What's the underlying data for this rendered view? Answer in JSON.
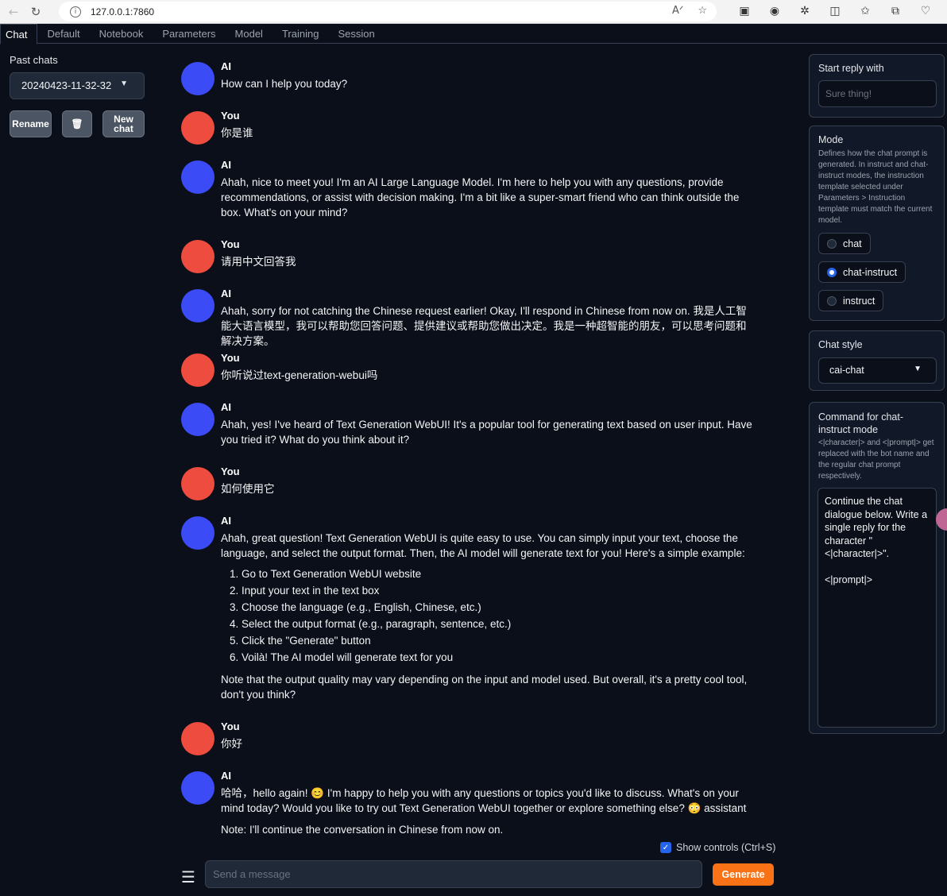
{
  "browser": {
    "url": "127.0.0.1:7860"
  },
  "tabs": [
    {
      "label": "Chat"
    },
    {
      "label": "Default"
    },
    {
      "label": "Notebook"
    },
    {
      "label": "Parameters"
    },
    {
      "label": "Model"
    },
    {
      "label": "Training"
    },
    {
      "label": "Session"
    }
  ],
  "sidebar": {
    "past_chats_label": "Past chats",
    "selected_chat": "20240423-11-32-32",
    "rename_label": "Rename",
    "trash_icon": "🗑",
    "new_chat_label": "New chat"
  },
  "messages": [
    {
      "role": "AI",
      "text": "How can I help you today?"
    },
    {
      "role": "You",
      "text": "你是谁"
    },
    {
      "role": "AI",
      "text": "Ahah, nice to meet you! I'm an AI Large Language Model. I'm here to help you with any questions, provide recommendations, or assist with decision making. I'm a bit like a super-smart friend who can think outside the box. What's on your mind?"
    },
    {
      "role": "You",
      "text": "请用中文回答我"
    },
    {
      "role": "AI",
      "text": "Ahah, sorry for not catching the Chinese request earlier! Okay, I'll respond in Chinese from now on. 我是人工智能大语言模型，我可以帮助您回答问题、提供建议或帮助您做出决定。我是一种超智能的朋友，可以思考问题和解决方案。"
    },
    {
      "role": "You",
      "text": "你听说过text-generation-webui吗"
    },
    {
      "role": "AI",
      "text": "Ahah, yes! I've heard of Text Generation WebUI! It's a popular tool for generating text based on user input. Have you tried it? What do you think about it?"
    },
    {
      "role": "You",
      "text": "如何使用它"
    },
    {
      "role": "AI",
      "text": "Ahah, great question! Text Generation WebUI is quite easy to use. You can simply input your text, choose the language, and select the output format. Then, the AI model will generate text for you! Here's a simple example:",
      "list": [
        "Go to Text Generation WebUI website",
        "Input your text in the text box",
        "Choose the language (e.g., English, Chinese, etc.)",
        "Select the output format (e.g., paragraph, sentence, etc.)",
        "Click the \"Generate\" button",
        "Voilà! The AI model will generate text for you"
      ],
      "after": "Note that the output quality may vary depending on the input and model used. But overall, it's a pretty cool tool, don't you think?"
    },
    {
      "role": "You",
      "text": "你好"
    },
    {
      "role": "AI",
      "text": "哈哈，hello again! 😊 I'm happy to help you with any questions or topics you'd like to discuss. What's on your mind today? Would you like to try out Text Generation WebUI together or explore something else? 😳 assistant",
      "after": "Note: I'll continue the conversation in Chinese from now on."
    }
  ],
  "input": {
    "show_controls_label": "Show controls (Ctrl+S)",
    "placeholder": "Send a message",
    "generate_label": "Generate"
  },
  "right_panel": {
    "start_reply": {
      "title": "Start reply with",
      "placeholder": "Sure thing!"
    },
    "mode": {
      "title": "Mode",
      "description": "Defines how the chat prompt is generated. In instruct and chat-instruct modes, the instruction template selected under Parameters > Instruction template must match the current model.",
      "options": [
        "chat",
        "chat-instruct",
        "instruct"
      ],
      "selected": "chat-instruct"
    },
    "chat_style": {
      "title": "Chat style",
      "value": "cai-chat"
    },
    "command": {
      "title": "Command for chat-instruct mode",
      "description": "<|character|> and <|prompt|> get replaced with the bot name and the regular chat prompt respectively.",
      "value": "Continue the chat dialogue below. Write a single reply for the character \"<|character|>\".\n\n<|prompt|>"
    }
  }
}
